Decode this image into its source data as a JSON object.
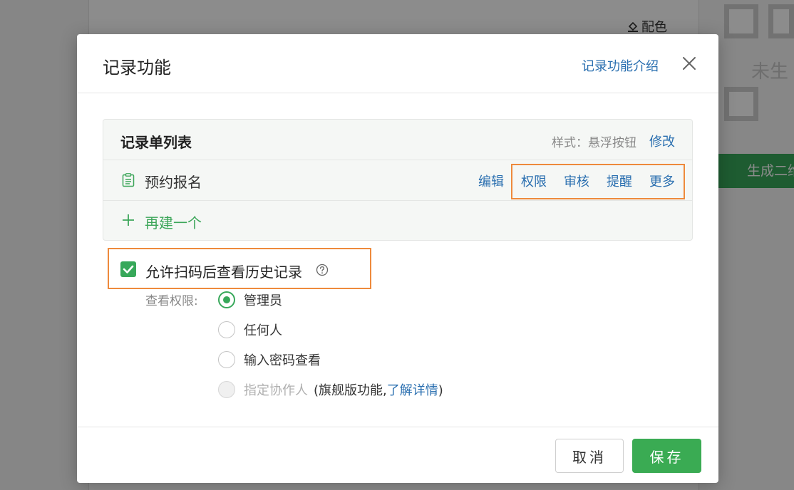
{
  "background": {
    "palette_label": "配色",
    "qr_text": "未生",
    "generate_button": "生成二维"
  },
  "modal": {
    "title": "记录功能",
    "intro_link": "记录功能介绍",
    "list": {
      "title": "记录单列表",
      "style_label": "样式：悬浮按钮",
      "modify_label": "修改",
      "items": [
        {
          "name": "预约报名",
          "actions": [
            "编辑",
            "权限",
            "审核",
            "提醒",
            "更多"
          ]
        }
      ],
      "add_label": "再建一个"
    },
    "allow_history": {
      "checked": true,
      "label": "允许扫码后查看历史记录"
    },
    "permission": {
      "label": "查看权限:",
      "options": [
        {
          "label": "管理员",
          "selected": true,
          "disabled": false
        },
        {
          "label": "任何人",
          "selected": false,
          "disabled": false
        },
        {
          "label": "输入密码查看",
          "selected": false,
          "disabled": false
        },
        {
          "label": "指定协作人",
          "selected": false,
          "disabled": true
        }
      ],
      "flagship_note_prefix": "(旗舰版功能,",
      "flagship_note_link": "了解详情",
      "flagship_note_suffix": ")"
    },
    "footer": {
      "cancel": "取消",
      "save": "保存"
    }
  },
  "colors": {
    "accent_green": "#37a85a",
    "link_blue": "#2a6fb0",
    "highlight_orange": "#ee8a3c"
  }
}
